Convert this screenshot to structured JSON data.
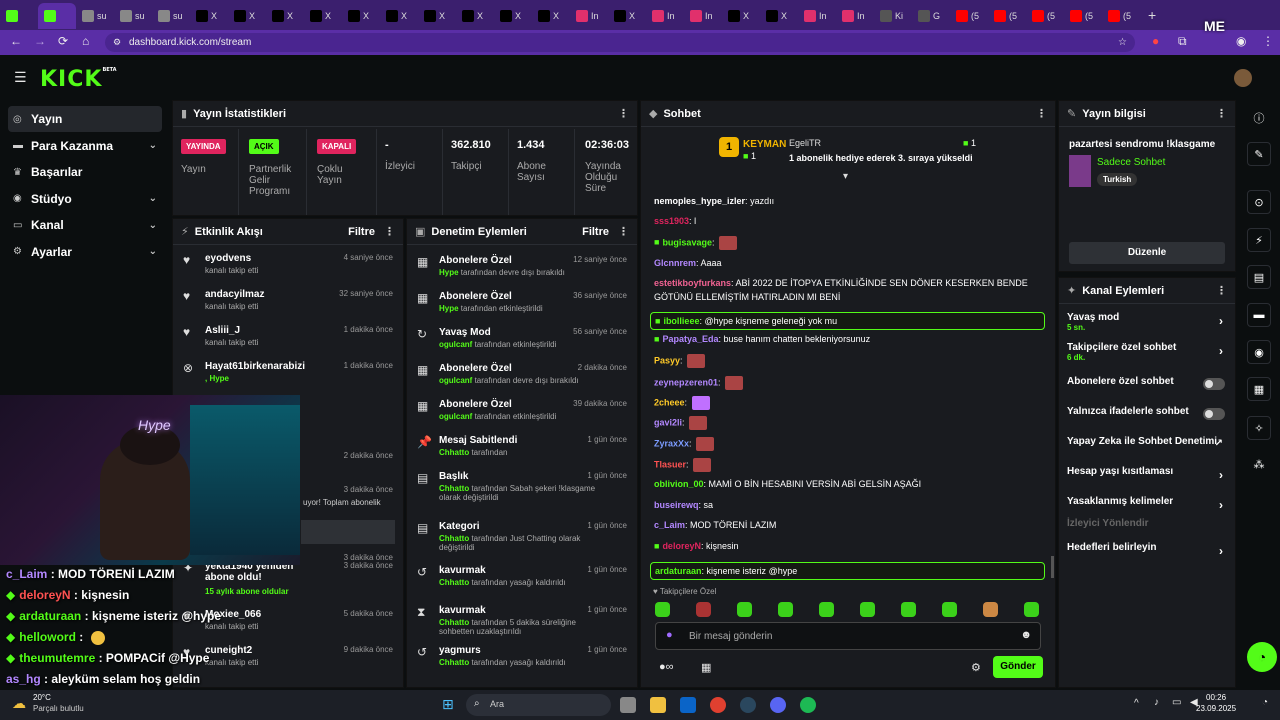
{
  "browser": {
    "tabs": [
      {
        "label": "",
        "icon": "kick-icon",
        "color": "#53fc18"
      },
      {
        "label": "",
        "icon": "kick-icon",
        "color": "#53fc18"
      },
      {
        "label": "su",
        "icon": "globe-icon",
        "color": "#888"
      },
      {
        "label": "su",
        "icon": "globe-icon",
        "color": "#888"
      },
      {
        "label": "su",
        "icon": "globe-icon",
        "color": "#888"
      },
      {
        "label": "X",
        "icon": "x-icon",
        "color": "#000"
      },
      {
        "label": "X",
        "icon": "x-icon",
        "color": "#000"
      },
      {
        "label": "X",
        "icon": "x-icon",
        "color": "#000"
      },
      {
        "label": "X",
        "icon": "x-icon",
        "color": "#000"
      },
      {
        "label": "X",
        "icon": "x-icon",
        "color": "#000"
      },
      {
        "label": "X",
        "icon": "x-icon",
        "color": "#000"
      },
      {
        "label": "X",
        "icon": "x-icon",
        "color": "#000"
      },
      {
        "label": "X",
        "icon": "x-icon",
        "color": "#000"
      },
      {
        "label": "X",
        "icon": "x-icon",
        "color": "#000"
      },
      {
        "label": "X",
        "icon": "x-icon",
        "color": "#000"
      },
      {
        "label": "In",
        "icon": "instagram-icon",
        "color": "#e1306c"
      },
      {
        "label": "X",
        "icon": "x-icon",
        "color": "#000"
      },
      {
        "label": "In",
        "icon": "instagram-icon",
        "color": "#e1306c"
      },
      {
        "label": "In",
        "icon": "instagram-icon",
        "color": "#e1306c"
      },
      {
        "label": "X",
        "icon": "x-icon",
        "color": "#000"
      },
      {
        "label": "X",
        "icon": "x-icon",
        "color": "#000"
      },
      {
        "label": "In",
        "icon": "instagram-icon",
        "color": "#e1306c"
      },
      {
        "label": "In",
        "icon": "instagram-icon",
        "color": "#e1306c"
      },
      {
        "label": "Ki",
        "icon": "page-icon",
        "color": "#555"
      },
      {
        "label": "G",
        "icon": "page-icon",
        "color": "#555"
      },
      {
        "label": "(5",
        "icon": "youtube-icon",
        "color": "#f00"
      },
      {
        "label": "(5",
        "icon": "youtube-icon",
        "color": "#f00"
      },
      {
        "label": "(5",
        "icon": "youtube-icon",
        "color": "#f00"
      },
      {
        "label": "(5",
        "icon": "youtube-icon",
        "color": "#f00"
      },
      {
        "label": "(5",
        "icon": "youtube-icon",
        "color": "#f00"
      }
    ],
    "url": "dashboard.kick.com/stream",
    "profile_badge": "ME"
  },
  "kick": {
    "logo": "KICK",
    "beta": "BETA"
  },
  "sidebar": {
    "items": [
      {
        "label": "Yayın",
        "icon": "broadcast-icon"
      },
      {
        "label": "Para Kazanma",
        "icon": "money-icon"
      },
      {
        "label": "Başarılar",
        "icon": "trophy-icon"
      },
      {
        "label": "Stüdyo",
        "icon": "studio-icon"
      },
      {
        "label": "Kanal",
        "icon": "channel-icon"
      },
      {
        "label": "Ayarlar",
        "icon": "gear-icon"
      }
    ]
  },
  "stats": {
    "title": "Yayın İstatistikleri",
    "live_badge": "YAYINDA",
    "live_label": "Yayın",
    "partner_badge": "AÇIK",
    "partner_label": "Partnerlik Gelir Programı",
    "multi_badge": "KAPALI",
    "multi_label": "Çoklu Yayın",
    "viewers_value": "-",
    "viewers_label": "İzleyici",
    "followers_value": "362.810",
    "followers_label": "Takipçi",
    "subs_value": "1.434",
    "subs_label": "Abone Sayısı",
    "uptime_value": "02:36:03",
    "uptime_label": "Yayında Olduğu Süre"
  },
  "activity": {
    "title": "Etkinlik Akışı",
    "filter": "Filtre",
    "items": [
      {
        "name": "eyodvens",
        "sub": "kanalı takip etti",
        "time": "4 saniye önce"
      },
      {
        "name": "andacyilmaz",
        "sub": "kanalı takip etti",
        "time": "32 saniye önce"
      },
      {
        "name": "Asliii_J",
        "sub": "kanalı takip etti",
        "time": "1 dakika önce"
      },
      {
        "name": "Hayat61birkenarabizi",
        "sub": ", Hype",
        "time": "1 dakika önce"
      },
      {
        "name": "",
        "sub": "",
        "time": "2 dakika önce"
      },
      {
        "name": "",
        "sub": "uyor! Toplam abonelik",
        "time": "3 dakika önce"
      },
      {
        "name": "",
        "sub": "",
        "time": "3 dakika önce"
      },
      {
        "name": "yekta1940 yeniden abone oldu!",
        "sub": "15 aylık abone oldular",
        "time": "3 dakika önce"
      },
      {
        "name": "Moxiee_066",
        "sub": "kanalı takip etti",
        "time": "5 dakika önce"
      },
      {
        "name": "cuneight2",
        "sub": "kanalı takip etti",
        "time": "9 dakika önce"
      }
    ]
  },
  "moderation": {
    "title": "Denetim Eylemleri",
    "filter": "Filtre",
    "items": [
      {
        "title": "Abonelere Özel",
        "actor": "Hype",
        "rest": "tarafından devre dışı bırakıldı",
        "time": "12 saniye önce"
      },
      {
        "title": "Abonelere Özel",
        "actor": "Hype",
        "rest": "tarafından etkinleştirildi",
        "time": "36 saniye önce"
      },
      {
        "title": "Yavaş Mod",
        "actor": "ogulcanf",
        "rest": "tarafından etkinleştirildi",
        "time": "56 saniye önce"
      },
      {
        "title": "Abonelere Özel",
        "actor": "ogulcanf",
        "rest": "tarafından devre dışı bırakıldı",
        "time": "2 dakika önce"
      },
      {
        "title": "Abonelere Özel",
        "actor": "ogulcanf",
        "rest": "tarafından etkinleştirildi",
        "time": "39 dakika önce"
      },
      {
        "title": "Mesaj Sabitlendi",
        "actor": "Chhatto",
        "rest": "tarafından",
        "time": "1 gün önce"
      },
      {
        "title": "Başlık",
        "actor": "Chhatto",
        "rest": "tarafından Sabah şekeri !klasgame olarak değiştirildi",
        "time": "1 gün önce"
      },
      {
        "title": "Kategori",
        "actor": "Chhatto",
        "rest": "tarafından Just Chatting olarak değiştirildi",
        "time": "1 gün önce"
      },
      {
        "title": "kavurmak",
        "actor": "Chhatto",
        "rest": "tarafından yasağı kaldırıldı",
        "time": "1 gün önce"
      },
      {
        "title": "kavurmak",
        "actor": "Chhatto",
        "rest": "tarafından 5 dakika süreliğine sohbetten uzaklaştırıldı",
        "time": "1 gün önce"
      },
      {
        "title": "yagmurs",
        "actor": "Chhatto",
        "rest": "tarafından yasağı kaldırıldı",
        "time": "1 gün önce"
      }
    ]
  },
  "chat": {
    "title": "Sohbet",
    "top_gifter": "KEYMAN",
    "top_gifter_count": "1",
    "gifter2": "EgeliTR",
    "gifter2_count": "1",
    "gifter2_msg": "1 abonelik hediye ederek 3. sıraya yükseldi",
    "messages": [
      {
        "user": "nemoples_hype_izler",
        "color": "#ffffff",
        "text": "yazdıı"
      },
      {
        "user": "sss1903",
        "color": "#e0245e",
        "text": "l"
      },
      {
        "user": "bugisavage",
        "color": "#53fc18",
        "text": ""
      },
      {
        "user": "Glcnnrem",
        "color": "#b388ff",
        "text": "Aaaa"
      },
      {
        "user": "estetikboyfurkans",
        "color": "#f06292",
        "text": "ABİ 2022 DE İTOPYA ETKİNLİĞİNDE SEN DÖNER KESERKEN BENDE"
      },
      {
        "user": "",
        "color": "#ffffff",
        "text": "GÖTÜNÜ ELLEMİŞTİM HATIRLADIN MI BENİ"
      },
      {
        "user": "ibollieee",
        "color": "#53fc18",
        "text": "@hype kişneme geleneği yok mu"
      },
      {
        "user": "Papatya_Eda",
        "color": "#b388ff",
        "text": "buse hanım chatten bekleniyorsunuz"
      },
      {
        "user": "Pasyy",
        "color": "#ffca28",
        "text": ""
      },
      {
        "user": "zeynepzeren01",
        "color": "#b388ff",
        "text": ""
      },
      {
        "user": "2cheee",
        "color": "#ffca28",
        "text": ""
      },
      {
        "user": "gavi2li",
        "color": "#b388ff",
        "text": ""
      },
      {
        "user": "ZyraxXx",
        "color": "#7c9cff",
        "text": ""
      },
      {
        "user": "Tlasuer",
        "color": "#ff5252",
        "text": ""
      },
      {
        "user": "oblivion_00",
        "color": "#53fc18",
        "text": "MAMİ O BİN HESABINI VERSİN ABİ GELSİN AŞAĞI"
      },
      {
        "user": "buseirewq",
        "color": "#b388ff",
        "text": "sa"
      },
      {
        "user": "c_Laim",
        "color": "#b388ff",
        "text": "MOD TÖRENİ LAZIM"
      },
      {
        "user": "deloreyN",
        "color": "#e0245e",
        "text": "kişnesin"
      },
      {
        "user": "ardaturaan",
        "color": "#53fc18",
        "text": "kişneme isteriz @hype"
      }
    ],
    "followers_only": "Takipçilere Özel",
    "input_placeholder": "Bir mesaj gönderin",
    "send": "Gönder"
  },
  "stream_info": {
    "title": "Yayın bilgisi",
    "stream_title": "pazartesi sendromu !klasgame",
    "category": "Sadece Sohbet",
    "tag": "Turkish",
    "edit": "Düzenle"
  },
  "channel_actions": {
    "title": "Kanal Eylemleri",
    "items": [
      {
        "label": "Yavaş mod",
        "sub": "5 sn."
      },
      {
        "label": "Takipçilere özel sohbet",
        "sub": "6 dk."
      },
      {
        "label": "Abonelere özel sohbet",
        "sub": ""
      },
      {
        "label": "Yalnızca ifadelerle sohbet",
        "sub": ""
      },
      {
        "label": "Yapay Zeka ile Sohbet Denetimi",
        "sub": ""
      },
      {
        "label": "Hesap yaşı kısıtlaması",
        "sub": ""
      },
      {
        "label": "Yasaklanmış kelimeler",
        "sub": ""
      },
      {
        "label": "İzleyici Yönlendir",
        "sub": ""
      },
      {
        "label": "Hedefleri belirleyin",
        "sub": ""
      }
    ]
  },
  "overlay_chat": [
    {
      "user": "c_Laim",
      "color": "#b388ff",
      "text": "MOD TÖRENİ LAZIM"
    },
    {
      "user": "deloreyN",
      "color": "#ff5252",
      "text": "kişnesin"
    },
    {
      "user": "ardaturaan",
      "color": "#53fc18",
      "text": "kişneme isteriz @hype"
    },
    {
      "user": "helloword",
      "color": "#53fc18",
      "text": ""
    },
    {
      "user": "theumutemre",
      "color": "#53fc18",
      "text": "POMPACif @Hype"
    },
    {
      "user": "as_hg",
      "color": "#b388ff",
      "text": "aleyküm selam hoş geldin"
    }
  ],
  "cam": {
    "neon": "Hype"
  },
  "taskbar": {
    "weather_temp": "20°C",
    "weather_desc": "Parçalı bulutlu",
    "search": "Ara",
    "time": "00:26",
    "date": "23.09.2025"
  }
}
